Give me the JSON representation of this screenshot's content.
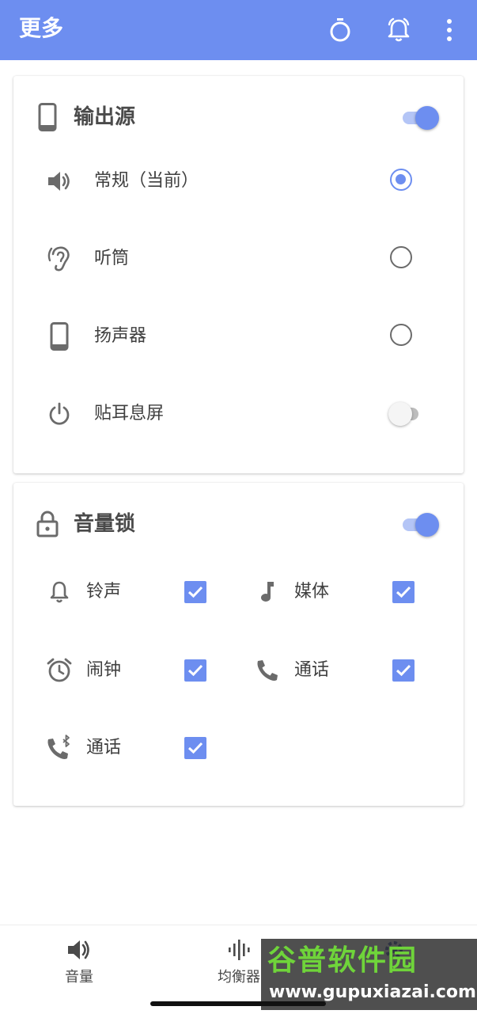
{
  "appbar": {
    "title": "更多",
    "icons": [
      "stopwatch-icon",
      "alarm-bell-icon",
      "more-vert-icon"
    ]
  },
  "output_source": {
    "title": "输出源",
    "icon": "phone-icon",
    "enabled": true,
    "options": [
      {
        "label": "常规（当前）",
        "icon": "speaker-icon",
        "selected": true
      },
      {
        "label": "听筒",
        "icon": "ear-icon",
        "selected": false
      },
      {
        "label": "扬声器",
        "icon": "phone-icon",
        "selected": false
      }
    ],
    "proximity": {
      "label": "贴耳息屏",
      "icon": "power-icon",
      "enabled": false
    }
  },
  "volume_lock": {
    "title": "音量锁",
    "icon": "lock-icon",
    "enabled": true,
    "items": [
      {
        "label": "铃声",
        "icon": "bell-icon",
        "checked": true
      },
      {
        "label": "媒体",
        "icon": "music-note-icon",
        "checked": true
      },
      {
        "label": "闹钟",
        "icon": "alarm-clock-icon",
        "checked": true
      },
      {
        "label": "通话",
        "icon": "phone-call-icon",
        "checked": true
      },
      {
        "label": "通话",
        "icon": "bluetooth-call-icon",
        "checked": true
      }
    ]
  },
  "bottom_nav": {
    "items": [
      {
        "label": "音量",
        "icon": "volume-icon"
      },
      {
        "label": "均衡器",
        "icon": "equalizer-icon"
      },
      {
        "label": "",
        "icon": "settings-icon"
      }
    ]
  },
  "watermark": {
    "title": "谷普软件园",
    "url": "www.gupuxiazai.com"
  },
  "colors": {
    "accent": "#6d8ef0",
    "accent_light": "#b4c5f6",
    "icon_gray": "#6b6b6b"
  }
}
